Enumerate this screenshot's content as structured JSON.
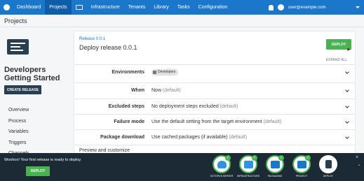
{
  "nav": {
    "items": [
      "Dashboard",
      "Projects",
      "Infrastructure",
      "Tenants",
      "Library",
      "Tasks",
      "Configuration"
    ],
    "active": "Projects",
    "user_email": "user@example.com"
  },
  "page": {
    "title": "Projects"
  },
  "project": {
    "name": "Developers Getting Started",
    "create_release_label": "CREATE RELEASE",
    "menu": [
      "Overview",
      "Process",
      "Variables",
      "Triggers",
      "Channels"
    ]
  },
  "release": {
    "link": "Release 0.0.1",
    "title": "Deploy release 0.0.1",
    "deploy_label": "DEPLOY",
    "expand_all": "EXPAND ALL",
    "rows": [
      {
        "label": "Environments",
        "chip": "Developers"
      },
      {
        "label": "When",
        "value": "Now",
        "muted": "(default)"
      },
      {
        "label": "Excluded steps",
        "value": "No deployment steps excluded",
        "muted": "(default)"
      },
      {
        "label": "Failure mode",
        "value": "Use the default setting from the target environment",
        "muted": "(default)"
      },
      {
        "label": "Package download",
        "value": "Use cached packages (if available)",
        "muted": "(default)"
      }
    ],
    "preview_label": "Preview and customize"
  },
  "onboarding": {
    "message": "Woohoo! Your first release is ready to deploy.",
    "deploy_label": "DEPLOY",
    "steps": [
      {
        "label": "OCTOPUS SERVER",
        "icon": "octopus-icon",
        "done": true
      },
      {
        "label": "INFRASTRUCTURE",
        "icon": "infrastructure-icon",
        "done": true
      },
      {
        "label": "PACKAGING",
        "icon": "packaging-icon",
        "done": true
      },
      {
        "label": "PROJECT",
        "icon": "project-icon",
        "done": true
      },
      {
        "label": "DEPLOY",
        "icon": "deploy-icon",
        "done": false
      }
    ],
    "close": "×",
    "collapse": "⌄"
  },
  "colors": {
    "nav_bg": "#1a77ca",
    "nav_active": "#0d5da8",
    "accent_green": "#48b350",
    "dark_navy": "#283e51",
    "bottom_bg": "#1c2a36"
  }
}
